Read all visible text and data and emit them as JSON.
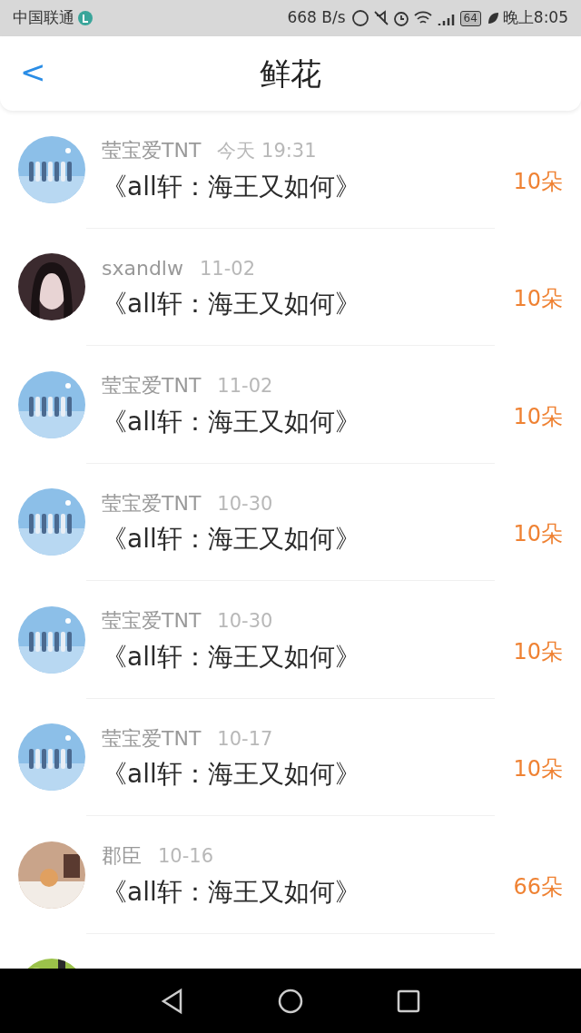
{
  "status_bar": {
    "carrier": "中国联通",
    "speed": "668 B/s",
    "battery": "64",
    "time": "晚上8:05"
  },
  "header": {
    "back": "<",
    "title": "鲜花"
  },
  "rows": [
    {
      "avatar": {
        "kind": "picture"
      },
      "user": "莹宝爱TNT",
      "date": "今天 19:31",
      "work": "《all轩：海王又如何》",
      "flowers": "10朵"
    },
    {
      "avatar": {
        "kind": "picture"
      },
      "user": "sxandlw",
      "date": "11-02",
      "work": "《all轩：海王又如何》",
      "flowers": "10朵"
    },
    {
      "avatar": {
        "kind": "picture"
      },
      "user": "莹宝爱TNT",
      "date": "11-02",
      "work": "《all轩：海王又如何》",
      "flowers": "10朵"
    },
    {
      "avatar": {
        "kind": "picture"
      },
      "user": "莹宝爱TNT",
      "date": "10-30",
      "work": "《all轩：海王又如何》",
      "flowers": "10朵"
    },
    {
      "avatar": {
        "kind": "picture"
      },
      "user": "莹宝爱TNT",
      "date": "10-30",
      "work": "《all轩：海王又如何》",
      "flowers": "10朵"
    },
    {
      "avatar": {
        "kind": "picture"
      },
      "user": "莹宝爱TNT",
      "date": "10-17",
      "work": "《all轩：海王又如何》",
      "flowers": "10朵"
    },
    {
      "avatar": {
        "kind": "picture"
      },
      "user": "郡臣",
      "date": "10-16",
      "work": "《all轩：海王又如何》",
      "flowers": "66朵"
    },
    {
      "avatar": {
        "kind": "picture"
      }
    }
  ]
}
